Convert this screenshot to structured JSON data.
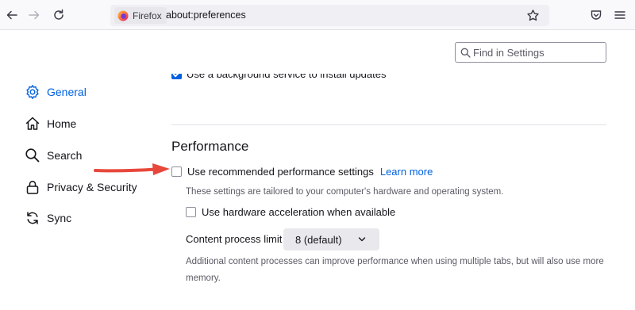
{
  "browser": {
    "identity_label": "Firefox",
    "url": "about:preferences"
  },
  "search": {
    "placeholder": "Find in Settings"
  },
  "sidebar": {
    "items": [
      {
        "label": "General",
        "icon": "gear-icon",
        "selected": true
      },
      {
        "label": "Home",
        "icon": "home-icon",
        "selected": false
      },
      {
        "label": "Search",
        "icon": "search-icon",
        "selected": false
      },
      {
        "label": "Privacy & Security",
        "icon": "lock-icon",
        "selected": false
      },
      {
        "label": "Sync",
        "icon": "sync-icon",
        "selected": false
      }
    ]
  },
  "content": {
    "clipped_option_label": "Use a background service to install updates",
    "performance": {
      "title": "Performance",
      "recommended": {
        "label": "Use recommended performance settings",
        "checked": false,
        "learn_more": "Learn more",
        "description": "These settings are tailored to your computer's hardware and operating system."
      },
      "hardware_accel": {
        "label": "Use hardware acceleration when available",
        "checked": false
      },
      "content_process": {
        "label": "Content process limit",
        "selected": "8 (default)",
        "description": "Additional content processes can improve performance when using multiple tabs, but will also use more memory."
      }
    }
  },
  "colors": {
    "accent": "#0061e0",
    "arrow": "#e8473b"
  }
}
